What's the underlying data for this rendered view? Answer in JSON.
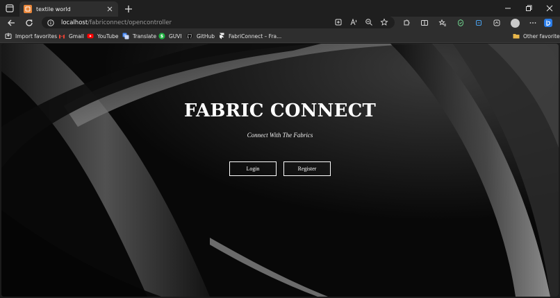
{
  "browser": {
    "tab": {
      "title": "textile world"
    },
    "address": {
      "host": "localhost",
      "path": "/fabriconnect/opencontroller"
    },
    "favorites": [
      {
        "label": "Import favorites",
        "icon": "import-icon"
      },
      {
        "label": "Gmail",
        "icon": "gmail-icon"
      },
      {
        "label": "YouTube",
        "icon": "youtube-icon"
      },
      {
        "label": "Translate",
        "icon": "translate-icon"
      },
      {
        "label": "GUVI",
        "icon": "guvi-icon"
      },
      {
        "label": "GitHub",
        "icon": "github-icon"
      },
      {
        "label": "FabriConnect – Fra...",
        "icon": "framer-icon"
      }
    ],
    "other_favorites": "Other favorites"
  },
  "page": {
    "title": "FABRIC CONNECT",
    "subtitle": "Connect With The Fabrics",
    "login_label": "Login",
    "register_label": "Register"
  },
  "colors": {
    "favicon": "#e8863a",
    "youtube": "#ff0000",
    "guvi": "#1fb141",
    "copilot": "#2b7de9"
  }
}
